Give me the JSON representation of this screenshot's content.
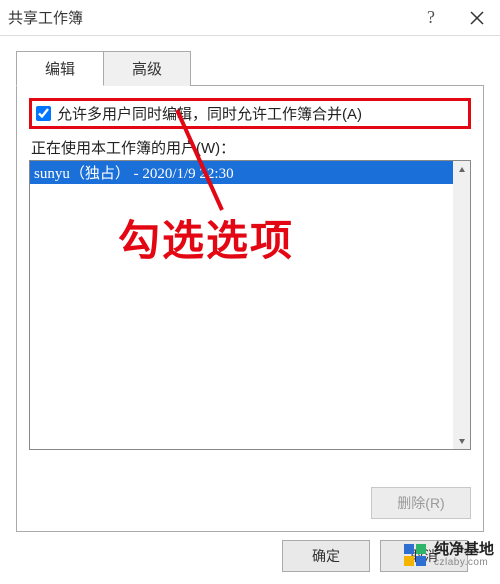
{
  "titlebar": {
    "title": "共享工作簿",
    "help": "?",
    "close": "×"
  },
  "tabs": [
    {
      "label": "编辑",
      "active": true
    },
    {
      "label": "高级",
      "active": false
    }
  ],
  "checkbox": {
    "label": "允许多用户同时编辑，同时允许工作簿合并(A)",
    "checked": true
  },
  "users_label": "正在使用本工作簿的用户(W)：",
  "users": [
    {
      "text": "sunyu（独占） - 2020/1/9 22:30",
      "selected": true
    }
  ],
  "buttons": {
    "remove": "删除(R)",
    "ok": "确定",
    "cancel": "取消"
  },
  "annotation": {
    "text": "勾选选项"
  },
  "watermark": {
    "name": "纯净基地",
    "url": "czlaby.com"
  }
}
